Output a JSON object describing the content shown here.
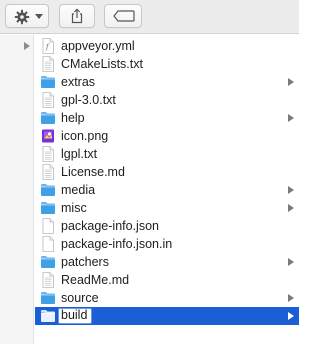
{
  "toolbar": {
    "action_icon": "gear-icon",
    "share_icon": "share-icon",
    "tags_icon": "tag-icon"
  },
  "colors": {
    "selection": "#1b5fd6",
    "folder": "#3fa0e8"
  },
  "files": [
    {
      "name": "appveyor.yml",
      "kind": "doc-yml",
      "folder": false
    },
    {
      "name": "CMakeLists.txt",
      "kind": "doc",
      "folder": false
    },
    {
      "name": "extras",
      "kind": "folder",
      "folder": true
    },
    {
      "name": "gpl-3.0.txt",
      "kind": "doc",
      "folder": false
    },
    {
      "name": "help",
      "kind": "folder",
      "folder": true
    },
    {
      "name": "icon.png",
      "kind": "image",
      "folder": false
    },
    {
      "name": "lgpl.txt",
      "kind": "doc",
      "folder": false
    },
    {
      "name": "License.md",
      "kind": "doc",
      "folder": false
    },
    {
      "name": "media",
      "kind": "folder",
      "folder": true
    },
    {
      "name": "misc",
      "kind": "folder",
      "folder": true
    },
    {
      "name": "package-info.json",
      "kind": "blank",
      "folder": false
    },
    {
      "name": "package-info.json.in",
      "kind": "blank",
      "folder": false
    },
    {
      "name": "patchers",
      "kind": "folder",
      "folder": true
    },
    {
      "name": "ReadMe.md",
      "kind": "doc",
      "folder": false
    },
    {
      "name": "source",
      "kind": "folder",
      "folder": true
    },
    {
      "name": "build",
      "kind": "folder",
      "folder": true,
      "selected": true,
      "editing": true
    }
  ]
}
